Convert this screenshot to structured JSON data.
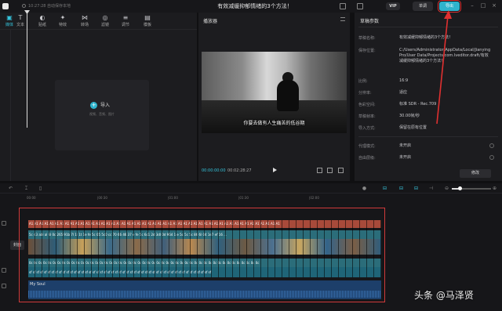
{
  "titlebar": {
    "draft_info": "10:27:28 自动保存本地",
    "title": "有效减缓抑郁情绪的3个方法！",
    "vip": "VIP",
    "share": "单调",
    "export": "导出",
    "window_controls": [
      "–",
      "□",
      "×"
    ]
  },
  "media": {
    "tools": [
      {
        "icon": "▣",
        "label": "媒体",
        "name": "media"
      },
      {
        "icon": "T",
        "label": "文本",
        "name": "text"
      },
      {
        "icon": "◐",
        "label": "贴纸",
        "name": "sticker"
      },
      {
        "icon": "✦",
        "label": "特效",
        "name": "effect"
      },
      {
        "icon": "⋈",
        "label": "转场",
        "name": "transition"
      },
      {
        "icon": "◎",
        "label": "滤镜",
        "name": "filter"
      },
      {
        "icon": "≡",
        "label": "调节",
        "name": "adjust"
      },
      {
        "icon": "▤",
        "label": "模板",
        "name": "template"
      }
    ],
    "import_label": "导入",
    "import_hint": "视频、音频、图片"
  },
  "player": {
    "title": "播放器",
    "subtitle": "你要去做有人生痛苦的低谷期",
    "time_current": "00:00:00:00",
    "time_total": "00:02:28:27"
  },
  "params": {
    "title": "草稿参数",
    "rows": [
      {
        "label": "草稿名称:",
        "value": "有效减缓抑郁情绪的3个方法！"
      },
      {
        "label": "保存位置:",
        "value": "C:/Users/Administrator/AppData/Local/JianyingPro/User Data/Projects/com.lveditor.draft/有效减缓抑郁情绪的3个方法！"
      },
      {
        "label": "比例:",
        "value": "16:9"
      },
      {
        "label": "分辨率:",
        "value": "适应"
      },
      {
        "label": "色彩空间:",
        "value": "标准 SDR - Rec.709"
      },
      {
        "label": "草稿帧率:",
        "value": "30.00帧/秒"
      },
      {
        "label": "导入方式:",
        "value": "保留在原有位置"
      },
      {
        "label": "代理模式:",
        "value": "未开启"
      },
      {
        "label": "自由层级:",
        "value": "未开启"
      }
    ],
    "edit": "修改"
  },
  "timeline": {
    "ruler": [
      "00:00",
      "|00:30",
      "|01:00",
      "|01:30",
      "|02:00"
    ],
    "cover": "封面",
    "audio_label": "My Soul",
    "row_a_text": "A1 A1 A1 A1 A1 A1 A1 A1 A1 A1 A1 A1 A1 A1 A1 A1 A1 A1 A1 A1 A1 A1 A1 A1 A1 A1 A1 A1 A1 A1 A1 A1 A1 A1 A1 A1 A1 A1 A1 A1 A1 A1 A1 A1 A1 A1 A1 A1 A1",
    "row_b_text": "5c 43 abl al 6l 0c 265 91b 7l 1l 1t 1e fe 5c 05 5c0 cc 70 66 46 37 e fe 5c 6c1 2d 3dl 0d 964 1 e 5c 5c 5c 86 6l 04 1e7 ef 16 ...",
    "row_d_text": "0c 0c 0c 0c 0c 0c 0c 0c 0c 0c 0c 0c 0c 0c 0c 0c 0c 0c 0c 0c 0c 0c 0c 0c 0c 0c 0c 0c 0c 0c 0c 0c 0c 0c 0c 0c 0c 0c 0c 0c 0c 0c 0c 0c 0c 0c 0c 0c 0c",
    "row_e_text": "sf sf sf sf sf sf sf sf sf sf sf sf sf sf sf sf sf sf sf sf sf sf sf sf sf sf sf sf sf sf sf sf sf sf sf sf sf sf sf sf sf sf sf sf sf sf sf sf sf"
  },
  "watermark": "头条 @马泽贤",
  "colors": {
    "accent": "#2fb3cc",
    "annotation": "#d03a3a",
    "panel": "#1c1c1f"
  }
}
